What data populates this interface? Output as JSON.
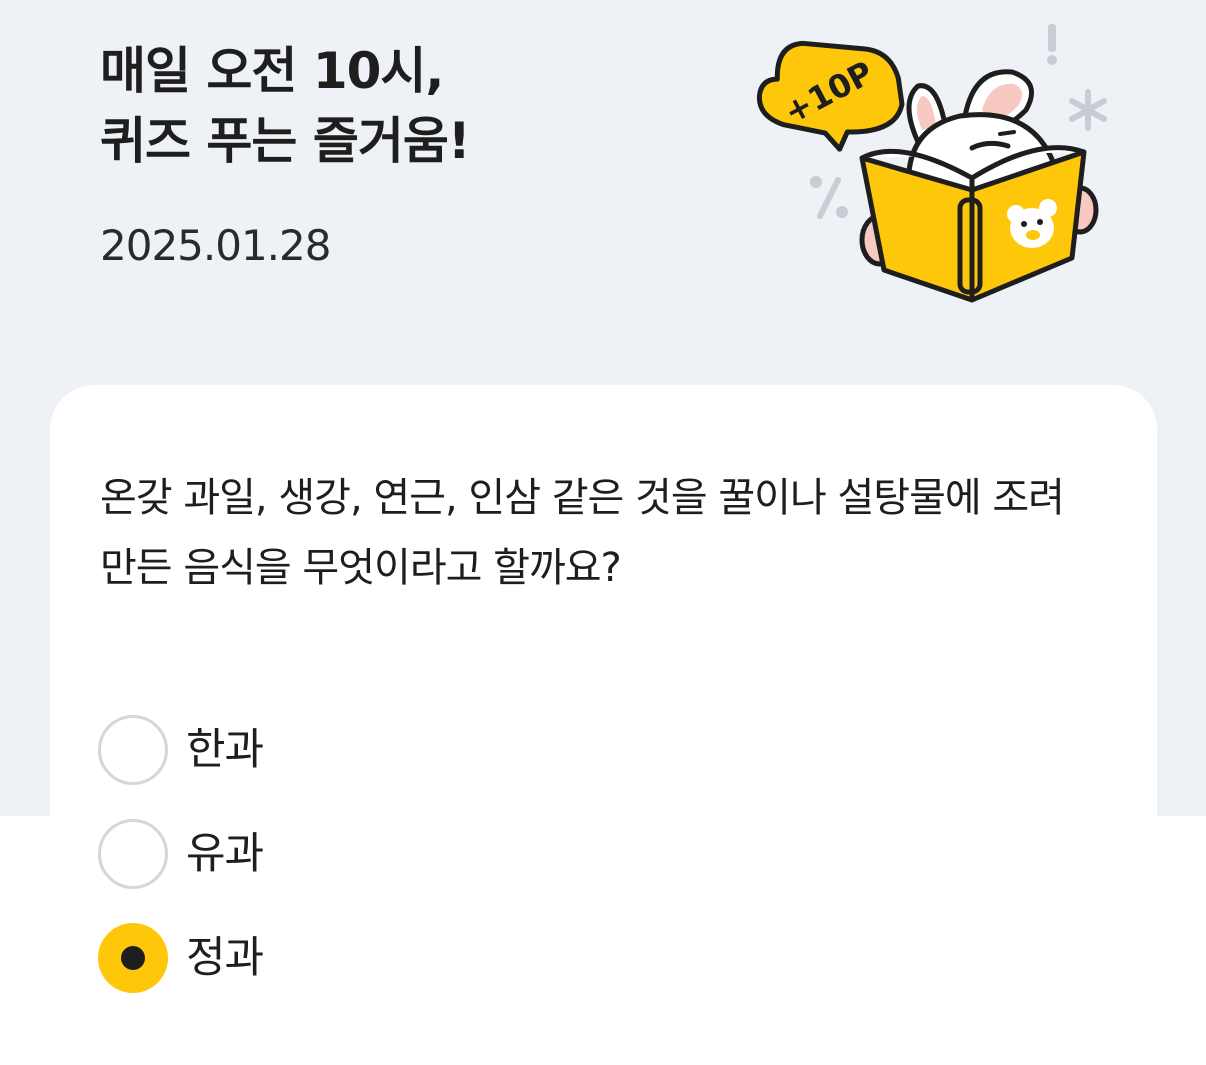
{
  "header": {
    "title_line1": "매일 오전 10시,",
    "title_line2": "퀴즈 푸는 즐거움!",
    "date": "2025.01.28",
    "badge_text": "+10P"
  },
  "quiz": {
    "question": "온갖 과일, 생강, 연근, 인삼 같은 것을 꿀이나 설탕물에 조려 만든 음식을 무엇이라고 할까요?",
    "options": [
      {
        "label": "한과",
        "selected": false
      },
      {
        "label": "유과",
        "selected": false
      },
      {
        "label": "정과",
        "selected": true
      }
    ]
  },
  "colors": {
    "background": "#eef1f6",
    "card": "#ffffff",
    "accent_yellow": "#fec70a",
    "text": "#1e1e1e",
    "radio_border": "#d6d6d6"
  },
  "icons": {
    "illustration": "rabbit-reading-book-icon",
    "selected_radio": "radio-checked-icon",
    "unselected_radio": "radio-empty-icon"
  }
}
